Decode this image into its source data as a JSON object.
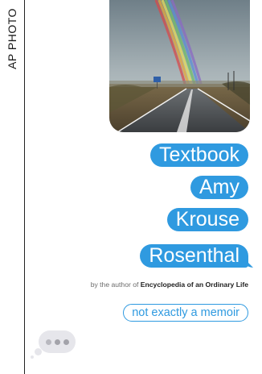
{
  "credit": {
    "text": "AP PHOTO"
  },
  "cover": {
    "title_bubbles": [
      "Textbook",
      "Amy",
      "Krouse",
      "Rosenthal"
    ],
    "byline": {
      "prefix": "by the author of ",
      "book": "Encyclopedia of an Ordinary Life"
    },
    "subtitle": "not exactly a memoir",
    "photo_icon": "rainbow-road-photo",
    "typing_icon": "typing-indicator-icon"
  },
  "colors": {
    "bubble_blue": "#2f9ae0",
    "typing_gray": "#e6e6eb"
  }
}
